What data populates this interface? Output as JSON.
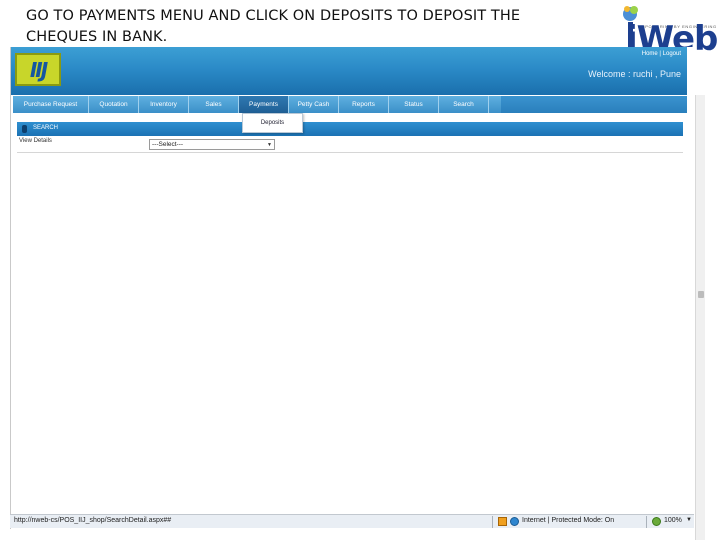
{
  "caption": "GO TO PAYMENTS MENU AND CLICK ON DEPOSITS TO DEPOSIT THE CHEQUES IN BANK.",
  "brand_logo": {
    "word": "iWeb",
    "tagline": "EMPOWERING BY ENGINEERING"
  },
  "app": {
    "logo_text": "IIJ",
    "header_links": "Home | Logout",
    "welcome": "Welcome : ruchi , Pune"
  },
  "menu": {
    "items": [
      {
        "label": "Purchase Request"
      },
      {
        "label": "Quotation"
      },
      {
        "label": "Inventory"
      },
      {
        "label": "Sales"
      },
      {
        "label": "Payments"
      },
      {
        "label": "Petty Cash"
      },
      {
        "label": "Reports"
      },
      {
        "label": "Status"
      },
      {
        "label": "Search"
      }
    ],
    "active": "Payments",
    "submenu_item": "Deposits"
  },
  "search_panel": {
    "title": "SEARCH",
    "view_label": "View Details",
    "select_value": "---Select---"
  },
  "statusbar": {
    "url": "http://nweb-cs/POS_IIJ_shop/SearchDetail.aspx##",
    "zone": "Internet | Protected Mode: On",
    "zoom": "100%"
  },
  "colors": {
    "header_blue": "#2b8ac7",
    "menu_blue": "#3b8fc8",
    "logo_green": "#c8d62a",
    "brand_navy": "#1d3f8f"
  }
}
